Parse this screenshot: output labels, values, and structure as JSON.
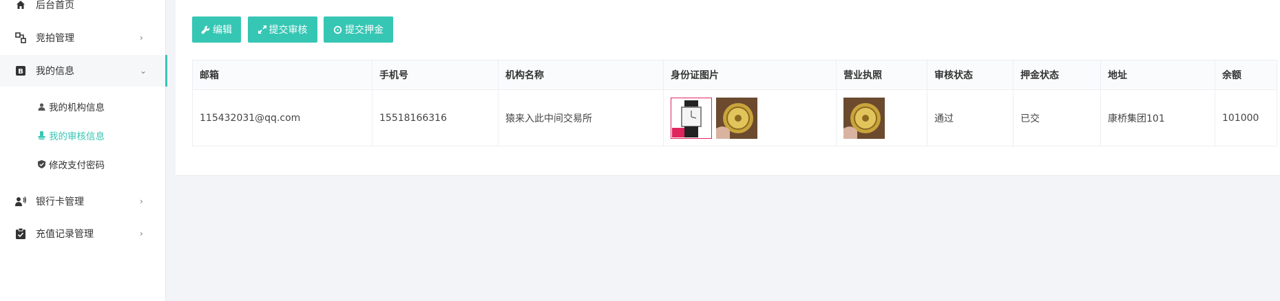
{
  "sidebar": {
    "items": [
      {
        "label": "后台首页",
        "icon": "home-icon"
      },
      {
        "label": "竞拍管理",
        "icon": "auction-icon"
      },
      {
        "label": "我的信息",
        "icon": "b-badge-icon"
      },
      {
        "label": "银行卡管理",
        "icon": "user-voice-icon"
      },
      {
        "label": "充值记录管理",
        "icon": "clipboard-check-icon"
      }
    ],
    "sub_items": [
      {
        "label": "我的机构信息",
        "icon": "user-icon"
      },
      {
        "label": "我的审核信息",
        "icon": "stamp-icon"
      },
      {
        "label": "修改支付密码",
        "icon": "shield-check-icon"
      }
    ]
  },
  "toolbar": {
    "edit_label": "编辑",
    "submit_review_label": "提交审核",
    "submit_deposit_label": "提交押金"
  },
  "table": {
    "headers": [
      "邮箱",
      "手机号",
      "机构名称",
      "身份证图片",
      "营业执照",
      "审核状态",
      "押金状态",
      "地址",
      "余额"
    ],
    "row": {
      "email": "115432031@qq.com",
      "phone": "15518166316",
      "org_name": "猿来入此中间交易所",
      "review_status": "通过",
      "deposit_status": "已交",
      "address": "康桥集团101",
      "balance": "101000"
    }
  },
  "colors": {
    "accent": "#36c6b4",
    "status_ok": "#2a9d3a",
    "background": "#f3f4f8"
  }
}
